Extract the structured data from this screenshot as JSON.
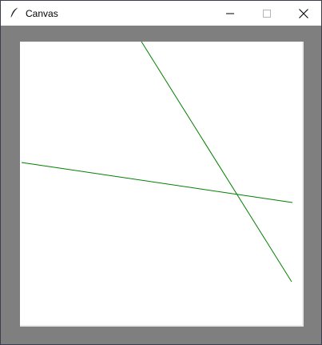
{
  "window": {
    "title": "Canvas",
    "controls": {
      "minimize": "minimize",
      "maximize": "maximize",
      "close": "close"
    }
  },
  "icons": {
    "app": "feather-icon",
    "minimize": "minimize-icon",
    "maximize": "maximize-icon",
    "close": "close-icon"
  },
  "colors": {
    "titlebar": "#ffffff",
    "client_background": "#7f7f7f",
    "canvas_background": "#ffffff",
    "line_color": "#008000"
  }
}
